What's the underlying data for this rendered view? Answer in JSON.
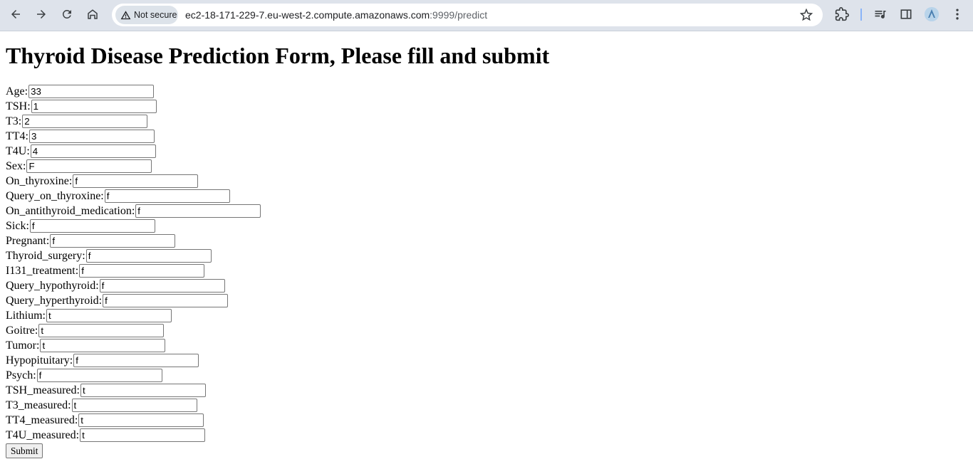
{
  "browser": {
    "security_label": "Not secure",
    "url_host": "ec2-18-171-229-7.eu-west-2.compute.amazonaws.com",
    "url_path": ":9999/predict"
  },
  "page": {
    "title": "Thyroid Disease Prediction Form, Please fill and submit",
    "submit_label": "Submit"
  },
  "fields": [
    {
      "label": "Age:",
      "value": "33"
    },
    {
      "label": "TSH:",
      "value": "1"
    },
    {
      "label": "T3:",
      "value": "2"
    },
    {
      "label": "TT4:",
      "value": "3"
    },
    {
      "label": "T4U:",
      "value": "4"
    },
    {
      "label": "Sex:",
      "value": "F"
    },
    {
      "label": "On_thyroxine:",
      "value": "f"
    },
    {
      "label": "Query_on_thyroxine:",
      "value": "f"
    },
    {
      "label": "On_antithyroid_medication:",
      "value": "f"
    },
    {
      "label": "Sick:",
      "value": "f"
    },
    {
      "label": "Pregnant:",
      "value": "f"
    },
    {
      "label": "Thyroid_surgery:",
      "value": "f"
    },
    {
      "label": "I131_treatment:",
      "value": "f"
    },
    {
      "label": "Query_hypothyroid:",
      "value": "f"
    },
    {
      "label": "Query_hyperthyroid:",
      "value": "f"
    },
    {
      "label": "Lithium:",
      "value": "t"
    },
    {
      "label": "Goitre:",
      "value": "t"
    },
    {
      "label": "Tumor:",
      "value": "t"
    },
    {
      "label": "Hypopituitary:",
      "value": "f"
    },
    {
      "label": "Psych:",
      "value": "f"
    },
    {
      "label": "TSH_measured:",
      "value": "t"
    },
    {
      "label": "T3_measured:",
      "value": "t"
    },
    {
      "label": "TT4_measured:",
      "value": "t"
    },
    {
      "label": "T4U_measured:",
      "value": "t"
    }
  ]
}
